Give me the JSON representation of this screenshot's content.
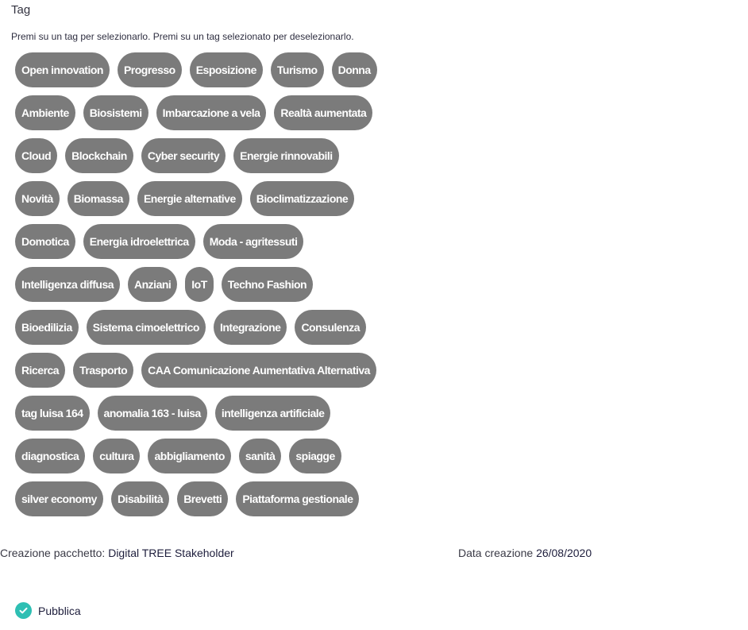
{
  "section_title": "Tag",
  "hint": "Premi su un tag per selezionarlo. Premi su un tag selezionato per deselezionarlo.",
  "tag_rows": [
    [
      "Open innovation",
      "Progresso",
      "Esposizione",
      "Turismo",
      "Donna"
    ],
    [
      "Ambiente",
      "Biosistemi",
      "Imbarcazione a vela",
      "Realtà aumentata"
    ],
    [
      "Cloud",
      "Blockchain",
      "Cyber security",
      "Energie rinnovabili"
    ],
    [
      "Novità",
      "Biomassa",
      "Energie alternative",
      "Bioclimatizzazione"
    ],
    [
      "Domotica",
      "Energia idroelettrica",
      "Moda - agritessuti"
    ],
    [
      "Intelligenza diffusa",
      "Anziani",
      "IoT",
      "Techno Fashion"
    ],
    [
      "Bioedilizia",
      "Sistema cimoelettrico",
      "Integrazione",
      "Consulenza"
    ],
    [
      "Ricerca",
      "Trasporto",
      "CAA Comunicazione Aumentativa Alternativa"
    ],
    [
      "tag luisa 164",
      "anomalia 163 - luisa",
      "intelligenza artificiale"
    ],
    [
      "diagnostica",
      "cultura",
      "abbigliamento",
      "sanità",
      "spiagge"
    ],
    [
      "silver economy",
      "Disabilità",
      "Brevetti",
      "Piattaforma gestionale"
    ]
  ],
  "package": {
    "label": "Creazione pacchetto:",
    "value": "Digital TREE Stakeholder"
  },
  "created": {
    "label": "Data creazione",
    "value": "26/08/2020"
  },
  "publish": {
    "label": "Pubblica",
    "icon": "check-circle-icon",
    "checked": true,
    "color": "#2ebfb3"
  },
  "colors": {
    "tag_bg": "#7b7b7b",
    "tag_text": "#ffffff"
  }
}
